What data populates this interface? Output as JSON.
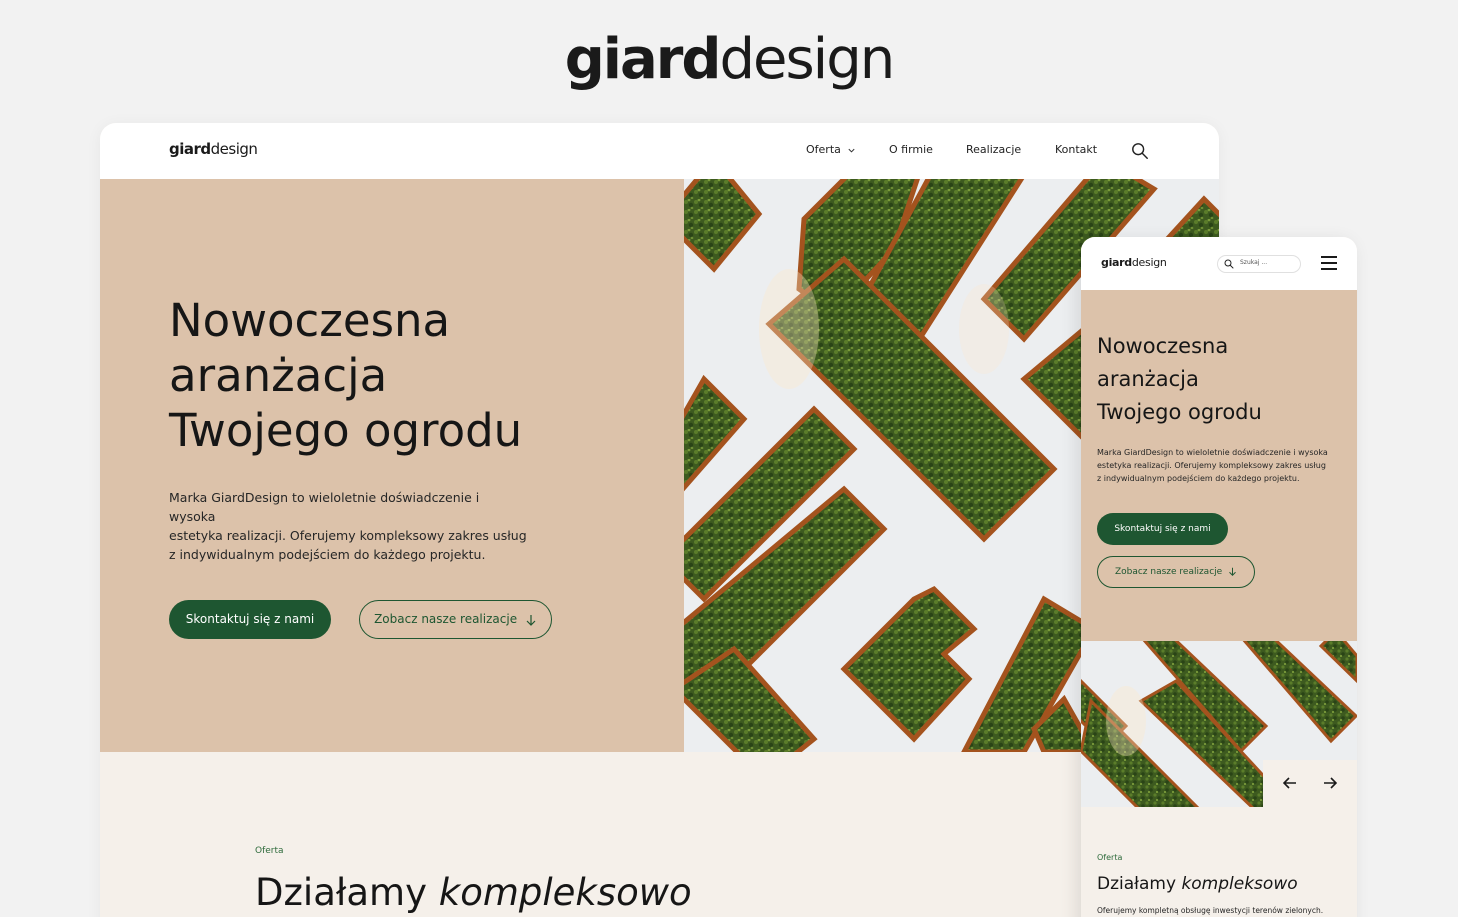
{
  "brand": {
    "bold": "giard",
    "light": "design"
  },
  "desktop": {
    "nav": {
      "oferta": "Oferta",
      "o_firmie": "O firmie",
      "realizacje": "Realizacje",
      "kontakt": "Kontakt"
    },
    "hero": {
      "title_line1": "Nowoczesna",
      "title_line2": "aranżacja",
      "title_line3": "Twojego ogrodu",
      "desc_line1": "Marka GiardDesign to wieloletnie doświadczenie i wysoka",
      "desc_line2": "estetyka realizacji. Oferujemy kompleksowy zakres usług",
      "desc_line3": "z indywidualnym podejściem do każdego projektu.",
      "primary_button": "Skontaktuj się z nami",
      "secondary_button": "Zobacz nasze realizacje"
    },
    "section": {
      "eyebrow": "Oferta",
      "title_plain": "Działamy ",
      "title_italic": "kompleksowo"
    }
  },
  "mobile": {
    "search_placeholder": "Szukaj ...",
    "hero": {
      "title_line1": "Nowoczesna",
      "title_line2": "aranżacja",
      "title_line3": "Twojego ogrodu",
      "desc_line1": "Marka GiardDesign to wieloletnie doświadczenie i wysoka",
      "desc_line2": "estetyka realizacji. Oferujemy kompleksowy zakres usług",
      "desc_line3": "z indywidualnym podejściem do każdego projektu.",
      "primary_button": "Skontaktuj się z nami",
      "secondary_button": "Zobacz nasze realizacje"
    },
    "section": {
      "eyebrow": "Oferta",
      "title_plain": "Działamy ",
      "title_italic": "kompleksowo",
      "desc": "Oferujemy kompletną obsługę inwestycji terenów zielonych."
    }
  },
  "colors": {
    "accent_green": "#1e5631",
    "hero_beige": "#dcc2aa",
    "section_bg": "#f5f0ea",
    "page_bg": "#f2f2f2"
  },
  "icons": [
    "search-icon",
    "chevron-down-icon",
    "arrow-down-icon",
    "hamburger-menu-icon",
    "arrow-left-icon",
    "arrow-right-icon"
  ]
}
